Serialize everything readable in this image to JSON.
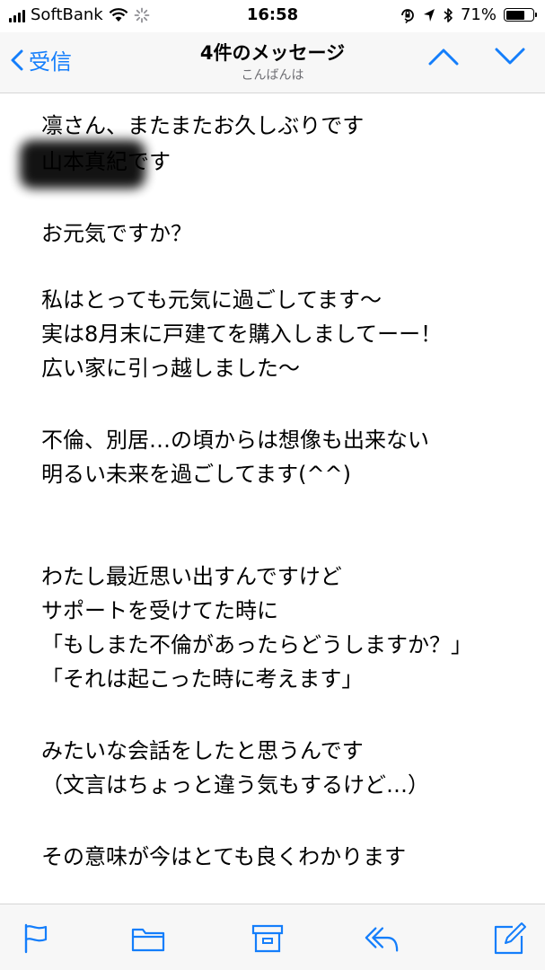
{
  "status": {
    "carrier": "SoftBank",
    "time": "16:58",
    "battery": "71%",
    "battery_level": 0.71,
    "icons": [
      "signal-icon",
      "wifi-icon",
      "loading-icon",
      "orientation-lock-icon",
      "location-icon",
      "bluetooth-icon",
      "battery-icon"
    ]
  },
  "nav": {
    "back_label": "受信",
    "title": "4件のメッセージ",
    "subtitle": "こんばんは",
    "up_icon": "chevron-up-icon",
    "down_icon": "chevron-down-icon",
    "accent": "#147efb"
  },
  "message": {
    "lines": [
      "凛さん、またまたお久しぶりです",
      "山本真紀です",
      "",
      "お元気ですか？",
      "",
      "私はとっても元気に過ごしてます〜",
      "実は8月末に戸建てを購入しましてーー！",
      "広い家に引っ越しました〜",
      "",
      "不倫、別居…の頃からは想像も出来ない",
      "明るい未来を過ごしてます(^^)",
      "",
      "",
      "わたし最近思い出すんですけど",
      "サポートを受けてた時に",
      "「もしまた不倫があったらどうしますか？」",
      "「それは起こった時に考えます」",
      "",
      "みたいな会話をしたと思うんです",
      "（文言はちょっと違う気もするけど…）",
      "",
      "その意味が今はとても良くわかります"
    ]
  },
  "toolbar": {
    "icons": [
      "flag-icon",
      "folder-icon",
      "archive-icon",
      "reply-icon",
      "compose-icon"
    ]
  }
}
